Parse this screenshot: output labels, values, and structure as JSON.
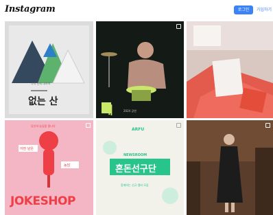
{
  "header": {
    "logo_text": "Instagram",
    "login_label": "로그인",
    "signup_label": "가입하기"
  },
  "posts": [
    {
      "headline": "없는 산",
      "caption": "나의 산에 대하여",
      "colors": {
        "bg": "#dcdcdc",
        "mountain_dark": "#34495e",
        "mountain_green": "#5db26e",
        "mountain_blue": "#2f7fc7"
      }
    },
    {
      "headline": "해",
      "caption": "2024 공연",
      "colors": {
        "bg": "#141a15",
        "accent": "#c9e86a"
      }
    },
    {
      "headline": "",
      "caption": "",
      "colors": {
        "bg": "#d9c8c2",
        "card": "#e54d3b"
      }
    },
    {
      "headline": "JOKESHOP",
      "caption": "당신의 농담을 팝니다",
      "badge_top": "어떤 날은",
      "badge_bottom": "농담",
      "colors": {
        "bg": "#f4b5c4",
        "mic": "#ef3f46",
        "text": "#ef3f46"
      }
    },
    {
      "headline": "혼돈선구단",
      "caption": "함께하는 신규 멤버 모집",
      "tag": "ARFU",
      "subhead": "NEWSROOM",
      "colors": {
        "bg": "#f2f2ea",
        "box": "#27c48b"
      }
    },
    {
      "headline": "",
      "caption": "",
      "colors": {
        "bg": "#5a3d2a",
        "figure": "#1c1c1c"
      }
    }
  ]
}
